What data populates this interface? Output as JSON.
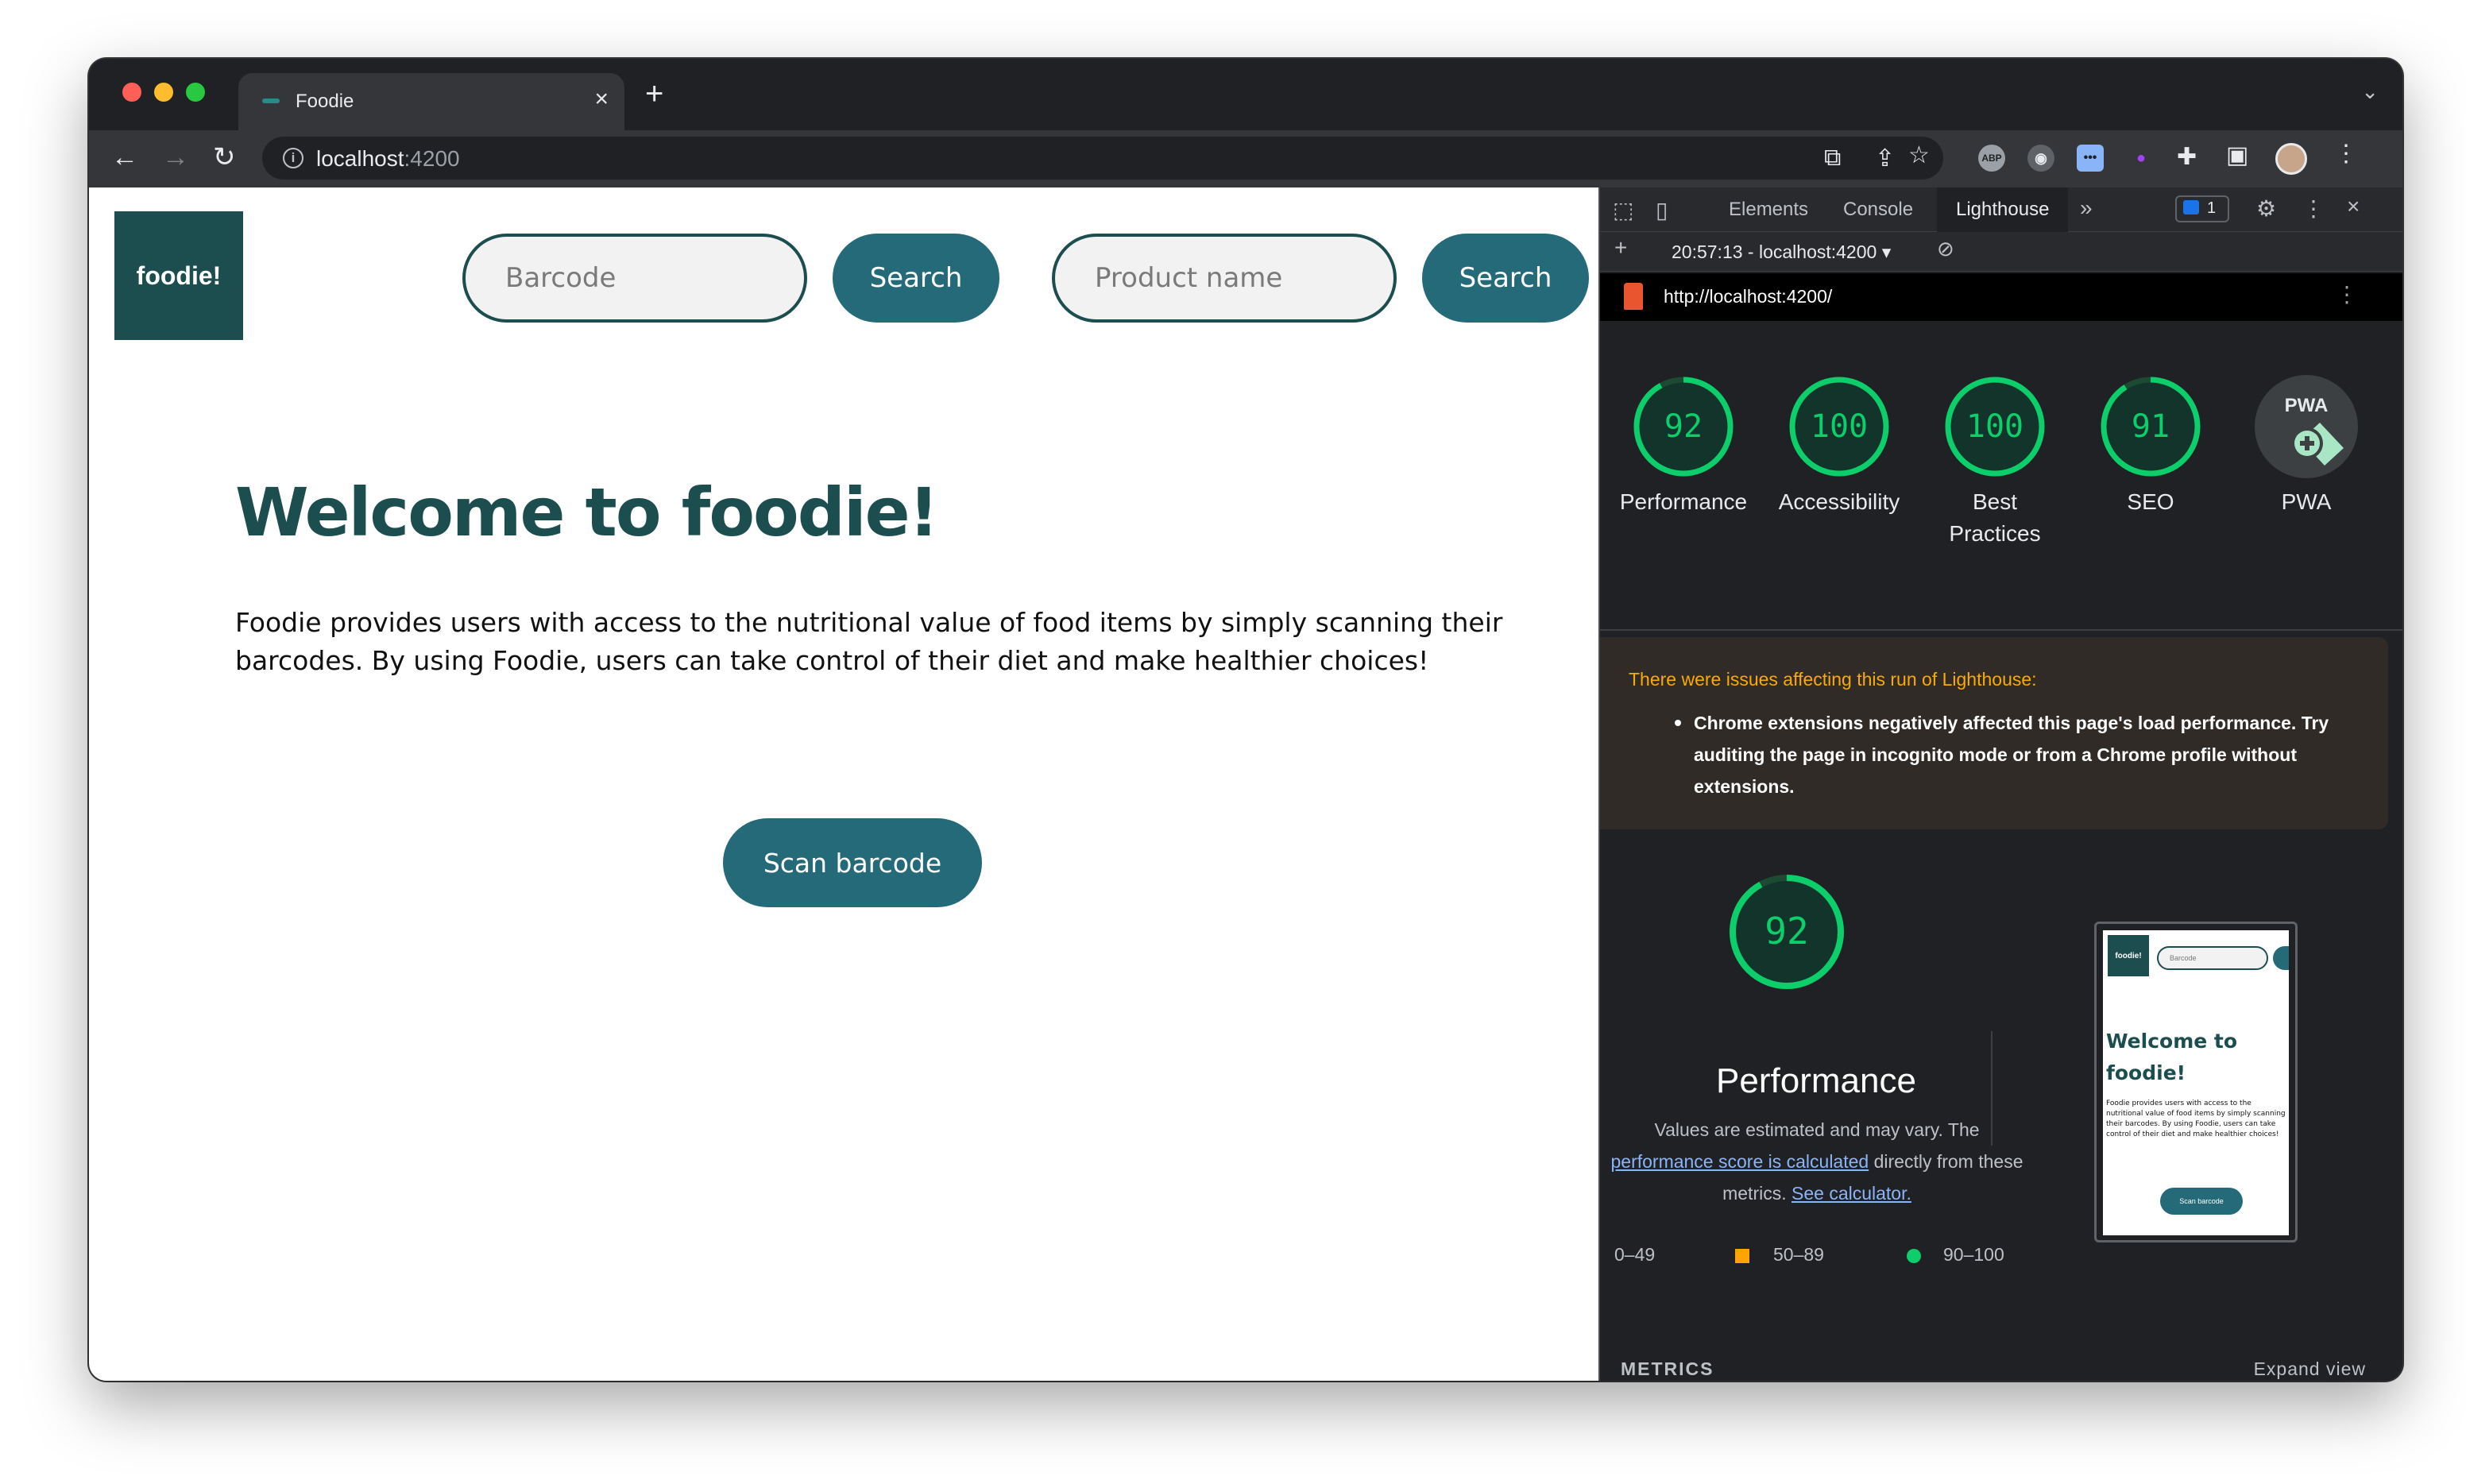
{
  "browser": {
    "tab_title": "Foodie",
    "url_host": "localhost",
    "url_port": ":4200"
  },
  "site": {
    "logo_text": "foodie!",
    "barcode_placeholder": "Barcode",
    "search_label_1": "Search",
    "product_placeholder": "Product name",
    "search_label_2": "Search",
    "heading": "Welcome to foodie!",
    "description": "Foodie provides users with access to the nutritional value of food items by simply scanning their barcodes. By using Foodie, users can take control of their diet and make healthier choices!",
    "scan_label": "Scan barcode"
  },
  "devtools": {
    "tabs": [
      "Elements",
      "Console",
      "Lighthouse"
    ],
    "issues_count": "1",
    "report_selector": "20:57:13 - localhost:4200",
    "report_url": "http://localhost:4200/",
    "scores": [
      {
        "label": "Performance",
        "value": 92
      },
      {
        "label": "Accessibility",
        "value": 100
      },
      {
        "label": "Best Practices",
        "value": 100
      },
      {
        "label": "SEO",
        "value": 91
      }
    ],
    "pwa_label": "PWA",
    "pwa_badge": "PWA",
    "warning_title": "There were issues affecting this run of Lighthouse:",
    "warning_item": "Chrome extensions negatively affected this page's load performance. Try auditing the page in incognito mode or from a Chrome profile without extensions.",
    "perf_score": 92,
    "perf_title": "Performance",
    "perf_note_1": "Values are estimated and may vary. The",
    "perf_note_link": "performance score is calculated",
    "perf_note_2": "directly from these metrics.",
    "perf_note_link2": "See calculator.",
    "legend": [
      "0–49",
      "50–89",
      "90–100"
    ],
    "metrics_label": "METRICS",
    "expand_label": "Expand view"
  },
  "thumbnail": {
    "logo": "foodie!",
    "barcode": "Barcode",
    "welcome": "Welcome to foodie!",
    "desc": "Foodie provides users with access to the nutritional value of food items by simply scanning their barcodes. By using Foodie, users can take control of their diet and make healthier choices!",
    "scan": "Scan barcode"
  },
  "colors": {
    "brand_dark": "#1c4d4f",
    "brand_button": "#256a78",
    "score_green": "#0cce6b",
    "score_orange": "#ffa400",
    "score_red": "#ff4e42"
  }
}
